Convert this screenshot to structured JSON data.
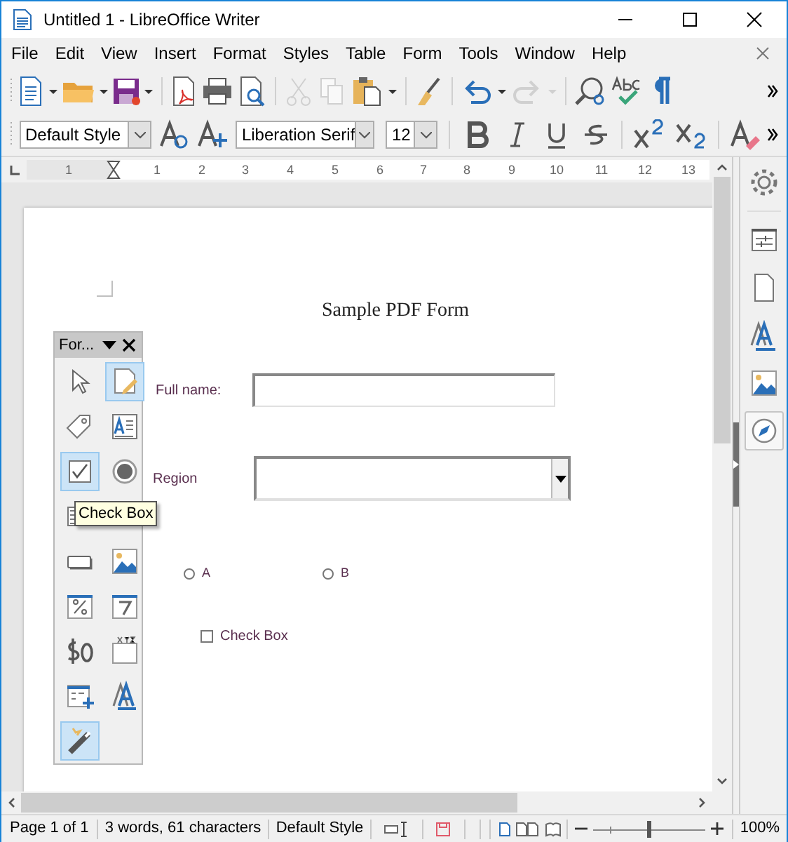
{
  "window": {
    "title": "Untitled 1 - LibreOffice Writer"
  },
  "menu": [
    "File",
    "Edit",
    "View",
    "Insert",
    "Format",
    "Styles",
    "Table",
    "Form",
    "Tools",
    "Window",
    "Help"
  ],
  "standard_toolbar": [
    {
      "kind": "new",
      "disabled": false
    },
    {
      "kind": "dropdown",
      "disabled": false
    },
    {
      "kind": "open",
      "disabled": false
    },
    {
      "kind": "dropdown",
      "disabled": false
    },
    {
      "kind": "save",
      "disabled": false
    },
    {
      "kind": "dropdown",
      "disabled": false
    },
    {
      "kind": "separator"
    },
    {
      "kind": "pdf",
      "disabled": false
    },
    {
      "kind": "print",
      "disabled": false
    },
    {
      "kind": "preview",
      "disabled": false
    },
    {
      "kind": "separator"
    },
    {
      "kind": "cut",
      "disabled": true
    },
    {
      "kind": "copy",
      "disabled": true
    },
    {
      "kind": "paste",
      "disabled": false
    },
    {
      "kind": "dropdown",
      "disabled": false
    },
    {
      "kind": "separator"
    },
    {
      "kind": "brush",
      "disabled": false
    },
    {
      "kind": "separator"
    },
    {
      "kind": "undo",
      "disabled": false
    },
    {
      "kind": "dropdown",
      "disabled": false
    },
    {
      "kind": "redo",
      "disabled": true
    },
    {
      "kind": "dropdown",
      "disabled": true
    },
    {
      "kind": "separator"
    },
    {
      "kind": "find",
      "disabled": false
    },
    {
      "kind": "spell",
      "disabled": false
    },
    {
      "kind": "pilcrow",
      "disabled": false
    }
  ],
  "formatting_toolbar": {
    "paragraph_style": "Default Style",
    "font_name": "Liberation Serif",
    "font_size": "12"
  },
  "ruler": {
    "labels": [
      "1",
      "1",
      "2",
      "3",
      "4",
      "5",
      "6",
      "7",
      "8",
      "9",
      "10",
      "11",
      "12",
      "13"
    ]
  },
  "document": {
    "title": "Sample PDF Form",
    "full_name_label": "Full name:",
    "region_label": "Region",
    "radios": [
      {
        "label": "A",
        "selected": false
      },
      {
        "label": "B",
        "selected": false
      }
    ],
    "checkbox": {
      "label": "Check Box",
      "checked": false
    }
  },
  "form_toolbar": {
    "title": "For...",
    "tooltip": "Check Box",
    "rows": [
      [
        {
          "kind": "select",
          "selected": false
        },
        {
          "kind": "design",
          "selected": true
        }
      ],
      [
        {
          "kind": "label",
          "selected": false
        },
        {
          "kind": "textbox",
          "selected": false
        }
      ],
      [
        {
          "kind": "checkbox",
          "selected": true
        },
        {
          "kind": "radio",
          "selected": false
        }
      ],
      [
        {
          "kind": "listbox",
          "selected": false
        }
      ],
      [
        {
          "kind": "pushbutton",
          "selected": false
        },
        {
          "kind": "image",
          "selected": false
        }
      ],
      [
        {
          "kind": "formatted",
          "selected": false
        },
        {
          "kind": "date",
          "selected": false
        }
      ],
      [
        {
          "kind": "currency",
          "selected": false
        },
        {
          "kind": "pattern",
          "selected": false
        }
      ],
      [
        {
          "kind": "table",
          "selected": false
        },
        {
          "kind": "fontwork",
          "selected": false
        }
      ],
      [
        {
          "kind": "wizard",
          "selected": true
        }
      ]
    ]
  },
  "sidebar": [
    {
      "kind": "settings",
      "selected": false
    },
    {
      "kind": "properties",
      "selected": false
    },
    {
      "kind": "page",
      "selected": false
    },
    {
      "kind": "styles",
      "selected": false
    },
    {
      "kind": "gallery",
      "selected": false
    },
    {
      "kind": "navigator",
      "selected": true
    }
  ],
  "status_bar": {
    "page": "Page 1 of 1",
    "words": "3 words, 61 characters",
    "style": "Default Style",
    "modified": true,
    "zoom": {
      "level": 0.5
    },
    "zoom_percent": "100%"
  }
}
